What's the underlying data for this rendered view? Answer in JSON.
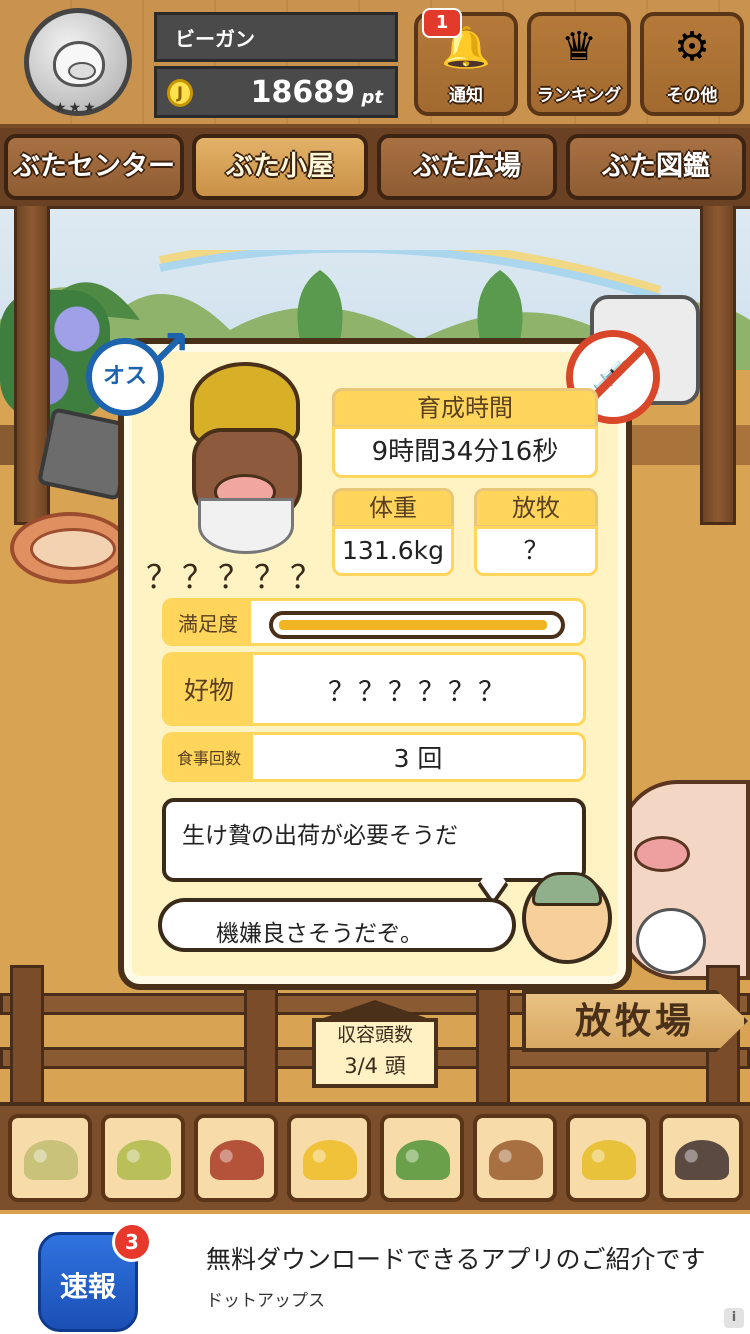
{
  "header": {
    "player_name": "ビーガン",
    "coin_symbol": "J",
    "points": "18689",
    "points_unit": "pt",
    "buttons": [
      {
        "label": "通知",
        "icon": "bell-icon",
        "badge": "1"
      },
      {
        "label": "ランキング",
        "icon": "crown-icon"
      },
      {
        "label": "その他",
        "icon": "gear-icon"
      }
    ],
    "avatar_stars": "★★★"
  },
  "tabs": [
    {
      "label": "ぶたセンター",
      "active": false
    },
    {
      "label": "ぶた小屋",
      "active": true
    },
    {
      "label": "ぶた広場",
      "active": false
    },
    {
      "label": "ぶた図鑑",
      "active": false
    }
  ],
  "pig": {
    "sex_label": "オス",
    "name": "？？？？？",
    "raising_time_label": "育成時間",
    "raising_time": "9時間34分16秒",
    "weight_label": "体重",
    "weight": "131.6kg",
    "grazing_label": "放牧",
    "grazing": "？",
    "satisfaction_label": "満足度",
    "satisfaction": 0.97,
    "favorite_label": "好物",
    "favorite": "？？？？？？",
    "meals_label": "食事回数",
    "meals": "3 回"
  },
  "messages": {
    "line1": "生け贄の出荷が必要そうだ",
    "line2": "機嫌良さそうだぞ。"
  },
  "capacity": {
    "label": "収容頭数",
    "value": "3/4 頭"
  },
  "ranch_sign": "放牧場",
  "foods": [
    {
      "icon": "grain-pile-icon",
      "color": "#c9c27a"
    },
    {
      "icon": "beans-pile-icon",
      "color": "#b9c05a"
    },
    {
      "icon": "sweet-potato-icon",
      "color": "#b5523a"
    },
    {
      "icon": "corn-icon",
      "color": "#f0c23a"
    },
    {
      "icon": "turnip-leaves-icon",
      "color": "#6aa04a"
    },
    {
      "icon": "acorn-icon",
      "color": "#a87040"
    },
    {
      "icon": "grain-dish-icon",
      "color": "#e8c23a"
    },
    {
      "icon": "truffle-dish-icon",
      "color": "#5a4a42"
    }
  ],
  "ad": {
    "icon_text": "速報",
    "badge": "3",
    "title": "無料ダウンロードできるアプリのご紹介です",
    "subtitle": "ドットアップス",
    "info": "i"
  }
}
